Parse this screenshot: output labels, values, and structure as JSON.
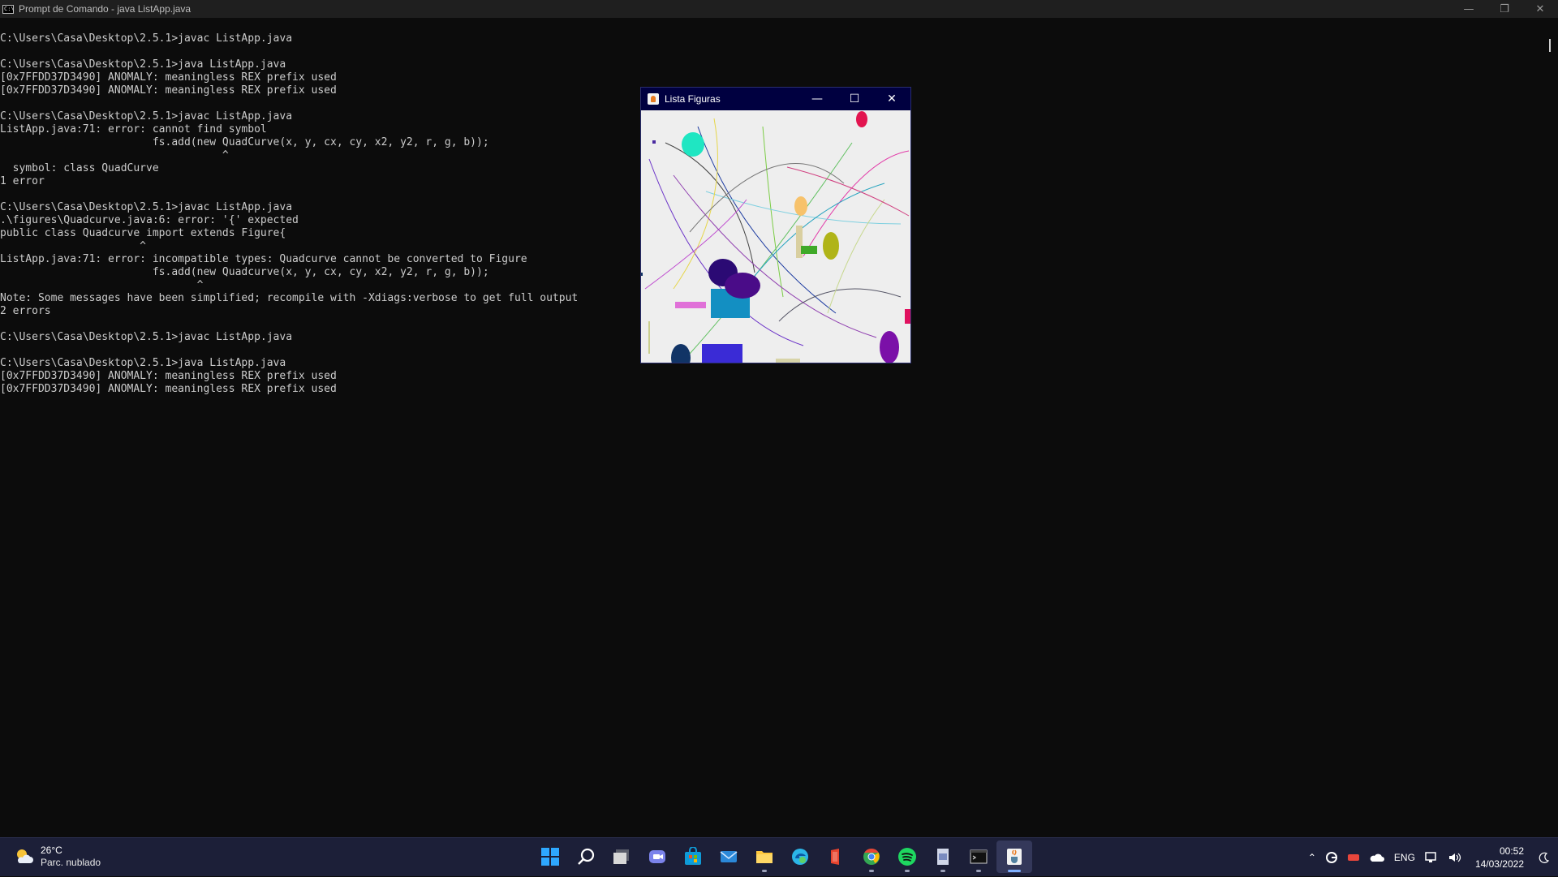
{
  "terminal": {
    "title": "Prompt de Comando - java  ListApp.java",
    "icon_text": "C:\\",
    "controls": [
      "minimize-icon",
      "restore-icon",
      "close-icon"
    ],
    "lines": [
      "C:\\Users\\Casa\\Desktop\\2.5.1>javac ListApp.java",
      "",
      "C:\\Users\\Casa\\Desktop\\2.5.1>java ListApp.java",
      "[0x7FFDD37D3490] ANOMALY: meaningless REX prefix used",
      "[0x7FFDD37D3490] ANOMALY: meaningless REX prefix used",
      "",
      "C:\\Users\\Casa\\Desktop\\2.5.1>javac ListApp.java",
      "ListApp.java:71: error: cannot find symbol",
      "                        fs.add(new QuadCurve(x, y, cx, cy, x2, y2, r, g, b));",
      "                                   ^",
      "  symbol: class QuadCurve",
      "1 error",
      "",
      "C:\\Users\\Casa\\Desktop\\2.5.1>javac ListApp.java",
      ".\\figures\\Quadcurve.java:6: error: '{' expected",
      "public class Quadcurve import extends Figure{",
      "                      ^",
      "ListApp.java:71: error: incompatible types: Quadcurve cannot be converted to Figure",
      "                        fs.add(new Quadcurve(x, y, cx, cy, x2, y2, r, g, b));",
      "                               ^",
      "Note: Some messages have been simplified; recompile with -Xdiags:verbose to get full output",
      "2 errors",
      "",
      "C:\\Users\\Casa\\Desktop\\2.5.1>javac ListApp.java",
      "",
      "C:\\Users\\Casa\\Desktop\\2.5.1>java ListApp.java",
      "[0x7FFDD37D3490] ANOMALY: meaningless REX prefix used",
      "[0x7FFDD37D3490] ANOMALY: meaningless REX prefix used"
    ]
  },
  "java_window": {
    "title": "Lista Figuras",
    "icon": "java-cup-icon",
    "controls": [
      "minimize-icon",
      "maximize-icon",
      "close-icon"
    ],
    "canvas_background": "#eeeeee"
  },
  "taskbar": {
    "weather": {
      "temp": "26°C",
      "description": "Parc. nublado",
      "icon": "partly-cloudy-icon"
    },
    "apps": [
      {
        "name": "start-icon",
        "color": "#2ea8ff"
      },
      {
        "name": "search-icon",
        "color": "#ffffff"
      },
      {
        "name": "task-view-icon",
        "color": "#ffffff"
      },
      {
        "name": "teams-chat-icon",
        "color": "#7b83eb"
      },
      {
        "name": "microsoft-store-icon",
        "color": "#0f9bd7"
      },
      {
        "name": "mail-icon",
        "color": "#2b88d8"
      },
      {
        "name": "file-explorer-icon",
        "color": "#ffc83d"
      },
      {
        "name": "edge-icon",
        "color": "#2bb6e8"
      },
      {
        "name": "office-icon",
        "color": "#e8442e"
      },
      {
        "name": "chrome-icon",
        "color": "#e8453c"
      },
      {
        "name": "spotify-icon",
        "color": "#1ed760"
      },
      {
        "name": "document-app-icon",
        "color": "#d0d6e8"
      },
      {
        "name": "terminal-icon",
        "color": "#cccccc"
      },
      {
        "name": "java-icon",
        "color": "#e87b22"
      }
    ],
    "tray": {
      "language": "ENG",
      "time": "00:52",
      "date": "14/03/2022"
    }
  }
}
